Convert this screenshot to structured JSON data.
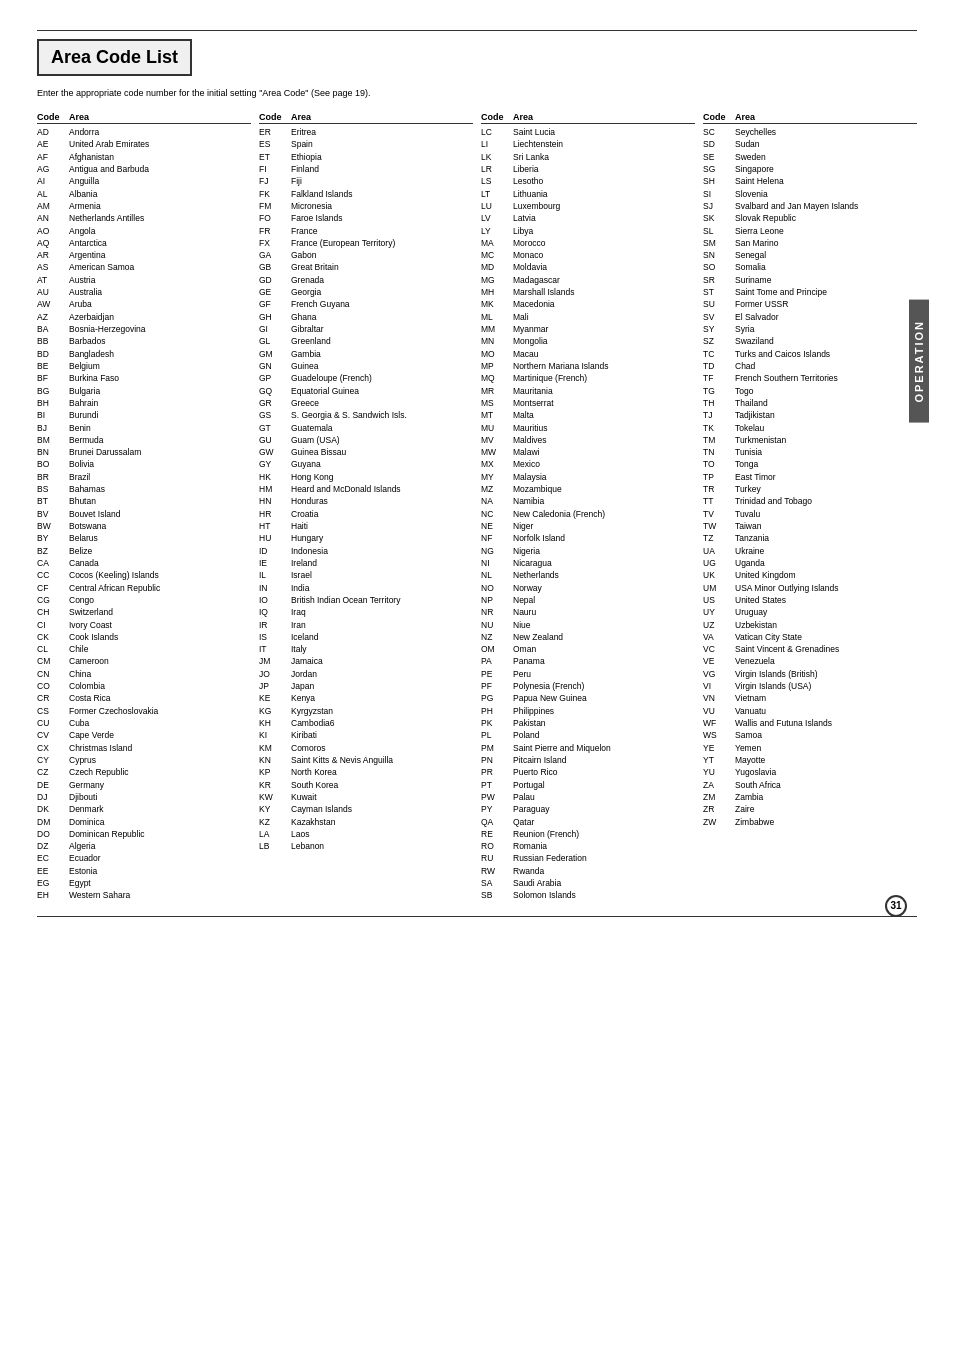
{
  "page": {
    "title": "Area Code List",
    "subtitle": "Enter the appropriate code number for the initial setting \"Area Code\" (See page 19).",
    "page_number": "31",
    "operation_label": "OPERATION"
  },
  "columns": [
    {
      "entries": [
        {
          "code": "AD",
          "area": "Andorra"
        },
        {
          "code": "AE",
          "area": "United Arab Emirates"
        },
        {
          "code": "AF",
          "area": "Afghanistan"
        },
        {
          "code": "AG",
          "area": "Antigua and Barbuda"
        },
        {
          "code": "AI",
          "area": "Anguilla"
        },
        {
          "code": "AL",
          "area": "Albania"
        },
        {
          "code": "AM",
          "area": "Armenia"
        },
        {
          "code": "AN",
          "area": "Netherlands Antilles"
        },
        {
          "code": "AO",
          "area": "Angola"
        },
        {
          "code": "AQ",
          "area": "Antarctica"
        },
        {
          "code": "AR",
          "area": "Argentina"
        },
        {
          "code": "AS",
          "area": "American Samoa"
        },
        {
          "code": "AT",
          "area": "Austria"
        },
        {
          "code": "AU",
          "area": "Australia"
        },
        {
          "code": "AW",
          "area": "Aruba"
        },
        {
          "code": "AZ",
          "area": "Azerbaidjan"
        },
        {
          "code": "BA",
          "area": "Bosnia-Herzegovina"
        },
        {
          "code": "BB",
          "area": "Barbados"
        },
        {
          "code": "BD",
          "area": "Bangladesh"
        },
        {
          "code": "BE",
          "area": "Belgium"
        },
        {
          "code": "BF",
          "area": "Burkina Faso"
        },
        {
          "code": "BG",
          "area": "Bulgaria"
        },
        {
          "code": "BH",
          "area": "Bahrain"
        },
        {
          "code": "BI",
          "area": "Burundi"
        },
        {
          "code": "BJ",
          "area": "Benin"
        },
        {
          "code": "BM",
          "area": "Bermuda"
        },
        {
          "code": "BN",
          "area": "Brunei Darussalam"
        },
        {
          "code": "BO",
          "area": "Bolivia"
        },
        {
          "code": "BR",
          "area": "Brazil"
        },
        {
          "code": "BS",
          "area": "Bahamas"
        },
        {
          "code": "BT",
          "area": "Bhutan"
        },
        {
          "code": "BV",
          "area": "Bouvet Island"
        },
        {
          "code": "BW",
          "area": "Botswana"
        },
        {
          "code": "BY",
          "area": "Belarus"
        },
        {
          "code": "BZ",
          "area": "Belize"
        },
        {
          "code": "CA",
          "area": "Canada"
        },
        {
          "code": "CC",
          "area": "Cocos (Keeling) Islands"
        },
        {
          "code": "CF",
          "area": "Central African Republic"
        },
        {
          "code": "CG",
          "area": "Congo"
        },
        {
          "code": "CH",
          "area": "Switzerland"
        },
        {
          "code": "CI",
          "area": "Ivory Coast"
        },
        {
          "code": "CK",
          "area": "Cook Islands"
        },
        {
          "code": "CL",
          "area": "Chile"
        },
        {
          "code": "CM",
          "area": "Cameroon"
        },
        {
          "code": "CN",
          "area": "China"
        },
        {
          "code": "CO",
          "area": "Colombia"
        },
        {
          "code": "CR",
          "area": "Costa Rica"
        },
        {
          "code": "CS",
          "area": "Former Czechoslovakia"
        },
        {
          "code": "CU",
          "area": "Cuba"
        },
        {
          "code": "CV",
          "area": "Cape Verde"
        },
        {
          "code": "CX",
          "area": "Christmas Island"
        },
        {
          "code": "CY",
          "area": "Cyprus"
        },
        {
          "code": "CZ",
          "area": "Czech Republic"
        },
        {
          "code": "DE",
          "area": "Germany"
        },
        {
          "code": "DJ",
          "area": "Djibouti"
        },
        {
          "code": "DK",
          "area": "Denmark"
        },
        {
          "code": "DM",
          "area": "Dominica"
        },
        {
          "code": "DO",
          "area": "Dominican Republic"
        },
        {
          "code": "DZ",
          "area": "Algeria"
        },
        {
          "code": "EC",
          "area": "Ecuador"
        },
        {
          "code": "EE",
          "area": "Estonia"
        },
        {
          "code": "EG",
          "area": "Egypt"
        },
        {
          "code": "EH",
          "area": "Western Sahara"
        }
      ]
    },
    {
      "entries": [
        {
          "code": "ER",
          "area": "Eritrea"
        },
        {
          "code": "ES",
          "area": "Spain"
        },
        {
          "code": "ET",
          "area": "Ethiopia"
        },
        {
          "code": "FI",
          "area": "Finland"
        },
        {
          "code": "FJ",
          "area": "Fiji"
        },
        {
          "code": "FK",
          "area": "Falkland Islands"
        },
        {
          "code": "FM",
          "area": "Micronesia"
        },
        {
          "code": "FO",
          "area": "Faroe Islands"
        },
        {
          "code": "FR",
          "area": "France"
        },
        {
          "code": "FX",
          "area": "France (European Territory)"
        },
        {
          "code": "GA",
          "area": "Gabon"
        },
        {
          "code": "GB",
          "area": "Great Britain"
        },
        {
          "code": "GD",
          "area": "Grenada"
        },
        {
          "code": "GE",
          "area": "Georgia"
        },
        {
          "code": "GF",
          "area": "French Guyana"
        },
        {
          "code": "GH",
          "area": "Ghana"
        },
        {
          "code": "GI",
          "area": "Gibraltar"
        },
        {
          "code": "GL",
          "area": "Greenland"
        },
        {
          "code": "GM",
          "area": "Gambia"
        },
        {
          "code": "GN",
          "area": "Guinea"
        },
        {
          "code": "GP",
          "area": "Guadeloupe (French)"
        },
        {
          "code": "GQ",
          "area": "Equatorial Guinea"
        },
        {
          "code": "GR",
          "area": "Greece"
        },
        {
          "code": "GS",
          "area": "S. Georgia & S. Sandwich Isls."
        },
        {
          "code": "GT",
          "area": "Guatemala"
        },
        {
          "code": "GU",
          "area": "Guam (USA)"
        },
        {
          "code": "GW",
          "area": "Guinea Bissau"
        },
        {
          "code": "GY",
          "area": "Guyana"
        },
        {
          "code": "HK",
          "area": "Hong Kong"
        },
        {
          "code": "HM",
          "area": "Heard and McDonald Islands"
        },
        {
          "code": "HN",
          "area": "Honduras"
        },
        {
          "code": "HR",
          "area": "Croatia"
        },
        {
          "code": "HT",
          "area": "Haiti"
        },
        {
          "code": "HU",
          "area": "Hungary"
        },
        {
          "code": "ID",
          "area": "Indonesia"
        },
        {
          "code": "IE",
          "area": "Ireland"
        },
        {
          "code": "IL",
          "area": "Israel"
        },
        {
          "code": "IN",
          "area": "India"
        },
        {
          "code": "IO",
          "area": "British Indian Ocean Territory"
        },
        {
          "code": "IQ",
          "area": "Iraq"
        },
        {
          "code": "IR",
          "area": "Iran"
        },
        {
          "code": "IS",
          "area": "Iceland"
        },
        {
          "code": "IT",
          "area": "Italy"
        },
        {
          "code": "JM",
          "area": "Jamaica"
        },
        {
          "code": "JO",
          "area": "Jordan"
        },
        {
          "code": "JP",
          "area": "Japan"
        },
        {
          "code": "KE",
          "area": "Kenya"
        },
        {
          "code": "KG",
          "area": "Kyrgyzstan"
        },
        {
          "code": "KH",
          "area": "Cambodia6"
        },
        {
          "code": "KI",
          "area": "Kiribati"
        },
        {
          "code": "KM",
          "area": "Comoros"
        },
        {
          "code": "KN",
          "area": "Saint Kitts & Nevis Anguilla"
        },
        {
          "code": "KP",
          "area": "North Korea"
        },
        {
          "code": "KR",
          "area": "South Korea"
        },
        {
          "code": "KW",
          "area": "Kuwait"
        },
        {
          "code": "KY",
          "area": "Cayman Islands"
        },
        {
          "code": "KZ",
          "area": "Kazakhstan"
        },
        {
          "code": "LA",
          "area": "Laos"
        },
        {
          "code": "LB",
          "area": "Lebanon"
        }
      ]
    },
    {
      "entries": [
        {
          "code": "LC",
          "area": "Saint Lucia"
        },
        {
          "code": "LI",
          "area": "Liechtenstein"
        },
        {
          "code": "LK",
          "area": "Sri Lanka"
        },
        {
          "code": "LR",
          "area": "Liberia"
        },
        {
          "code": "LS",
          "area": "Lesotho"
        },
        {
          "code": "LT",
          "area": "Lithuania"
        },
        {
          "code": "LU",
          "area": "Luxembourg"
        },
        {
          "code": "LV",
          "area": "Latvia"
        },
        {
          "code": "LY",
          "area": "Libya"
        },
        {
          "code": "MA",
          "area": "Morocco"
        },
        {
          "code": "MC",
          "area": "Monaco"
        },
        {
          "code": "MD",
          "area": "Moldavia"
        },
        {
          "code": "MG",
          "area": "Madagascar"
        },
        {
          "code": "MH",
          "area": "Marshall Islands"
        },
        {
          "code": "MK",
          "area": "Macedonia"
        },
        {
          "code": "ML",
          "area": "Mali"
        },
        {
          "code": "MM",
          "area": "Myanmar"
        },
        {
          "code": "MN",
          "area": "Mongolia"
        },
        {
          "code": "MO",
          "area": "Macau"
        },
        {
          "code": "MP",
          "area": "Northern Mariana Islands"
        },
        {
          "code": "MQ",
          "area": "Martinique (French)"
        },
        {
          "code": "MR",
          "area": "Mauritania"
        },
        {
          "code": "MS",
          "area": "Montserrat"
        },
        {
          "code": "MT",
          "area": "Malta"
        },
        {
          "code": "MU",
          "area": "Mauritius"
        },
        {
          "code": "MV",
          "area": "Maldives"
        },
        {
          "code": "MW",
          "area": "Malawi"
        },
        {
          "code": "MX",
          "area": "Mexico"
        },
        {
          "code": "MY",
          "area": "Malaysia"
        },
        {
          "code": "MZ",
          "area": "Mozambique"
        },
        {
          "code": "NA",
          "area": "Namibia"
        },
        {
          "code": "NC",
          "area": "New Caledonia (French)"
        },
        {
          "code": "NE",
          "area": "Niger"
        },
        {
          "code": "NF",
          "area": "Norfolk Island"
        },
        {
          "code": "NG",
          "area": "Nigeria"
        },
        {
          "code": "NI",
          "area": "Nicaragua"
        },
        {
          "code": "NL",
          "area": "Netherlands"
        },
        {
          "code": "NO",
          "area": "Norway"
        },
        {
          "code": "NP",
          "area": "Nepal"
        },
        {
          "code": "NR",
          "area": "Nauru"
        },
        {
          "code": "NU",
          "area": "Niue"
        },
        {
          "code": "NZ",
          "area": "New Zealand"
        },
        {
          "code": "OM",
          "area": "Oman"
        },
        {
          "code": "PA",
          "area": "Panama"
        },
        {
          "code": "PE",
          "area": "Peru"
        },
        {
          "code": "PF",
          "area": "Polynesia (French)"
        },
        {
          "code": "PG",
          "area": "Papua New Guinea"
        },
        {
          "code": "PH",
          "area": "Philippines"
        },
        {
          "code": "PK",
          "area": "Pakistan"
        },
        {
          "code": "PL",
          "area": "Poland"
        },
        {
          "code": "PM",
          "area": "Saint Pierre and Miquelon"
        },
        {
          "code": "PN",
          "area": "Pitcairn Island"
        },
        {
          "code": "PR",
          "area": "Puerto Rico"
        },
        {
          "code": "PT",
          "area": "Portugal"
        },
        {
          "code": "PW",
          "area": "Palau"
        },
        {
          "code": "PY",
          "area": "Paraguay"
        },
        {
          "code": "QA",
          "area": "Qatar"
        },
        {
          "code": "RE",
          "area": "Reunion (French)"
        },
        {
          "code": "RO",
          "area": "Romania"
        },
        {
          "code": "RU",
          "area": "Russian Federation"
        },
        {
          "code": "RW",
          "area": "Rwanda"
        },
        {
          "code": "SA",
          "area": "Saudi Arabia"
        },
        {
          "code": "SB",
          "area": "Solomon Islands"
        }
      ]
    },
    {
      "entries": [
        {
          "code": "SC",
          "area": "Seychelles"
        },
        {
          "code": "SD",
          "area": "Sudan"
        },
        {
          "code": "SE",
          "area": "Sweden"
        },
        {
          "code": "SG",
          "area": "Singapore"
        },
        {
          "code": "SH",
          "area": "Saint Helena"
        },
        {
          "code": "SI",
          "area": "Slovenia"
        },
        {
          "code": "SJ",
          "area": "Svalbard and Jan Mayen Islands"
        },
        {
          "code": "SK",
          "area": "Slovak Republic"
        },
        {
          "code": "SL",
          "area": "Sierra Leone"
        },
        {
          "code": "SM",
          "area": "San Marino"
        },
        {
          "code": "SN",
          "area": "Senegal"
        },
        {
          "code": "SO",
          "area": "Somalia"
        },
        {
          "code": "SR",
          "area": "Suriname"
        },
        {
          "code": "ST",
          "area": "Saint Tome and Principe"
        },
        {
          "code": "SU",
          "area": "Former USSR"
        },
        {
          "code": "SV",
          "area": "El Salvador"
        },
        {
          "code": "SY",
          "area": "Syria"
        },
        {
          "code": "SZ",
          "area": "Swaziland"
        },
        {
          "code": "TC",
          "area": "Turks and Caicos Islands"
        },
        {
          "code": "TD",
          "area": "Chad"
        },
        {
          "code": "TF",
          "area": "French Southern Territories"
        },
        {
          "code": "TG",
          "area": "Togo"
        },
        {
          "code": "TH",
          "area": "Thailand"
        },
        {
          "code": "TJ",
          "area": "Tadjikistan"
        },
        {
          "code": "TK",
          "area": "Tokelau"
        },
        {
          "code": "TM",
          "area": "Turkmenistan"
        },
        {
          "code": "TN",
          "area": "Tunisia"
        },
        {
          "code": "TO",
          "area": "Tonga"
        },
        {
          "code": "TP",
          "area": "East Timor"
        },
        {
          "code": "TR",
          "area": "Turkey"
        },
        {
          "code": "TT",
          "area": "Trinidad and Tobago"
        },
        {
          "code": "TV",
          "area": "Tuvalu"
        },
        {
          "code": "TW",
          "area": "Taiwan"
        },
        {
          "code": "TZ",
          "area": "Tanzania"
        },
        {
          "code": "UA",
          "area": "Ukraine"
        },
        {
          "code": "UG",
          "area": "Uganda"
        },
        {
          "code": "UK",
          "area": "United Kingdom"
        },
        {
          "code": "UM",
          "area": "USA Minor Outlying Islands"
        },
        {
          "code": "US",
          "area": "United States"
        },
        {
          "code": "UY",
          "area": "Uruguay"
        },
        {
          "code": "UZ",
          "area": "Uzbekistan"
        },
        {
          "code": "VA",
          "area": "Vatican City State"
        },
        {
          "code": "VC",
          "area": "Saint Vincent & Grenadines"
        },
        {
          "code": "VE",
          "area": "Venezuela"
        },
        {
          "code": "VG",
          "area": "Virgin Islands (British)"
        },
        {
          "code": "VI",
          "area": "Virgin Islands (USA)"
        },
        {
          "code": "VN",
          "area": "Vietnam"
        },
        {
          "code": "VU",
          "area": "Vanuatu"
        },
        {
          "code": "WF",
          "area": "Wallis and Futuna Islands"
        },
        {
          "code": "WS",
          "area": "Samoa"
        },
        {
          "code": "YE",
          "area": "Yemen"
        },
        {
          "code": "YT",
          "area": "Mayotte"
        },
        {
          "code": "YU",
          "area": "Yugoslavia"
        },
        {
          "code": "ZA",
          "area": "South Africa"
        },
        {
          "code": "ZM",
          "area": "Zambia"
        },
        {
          "code": "ZR",
          "area": "Zaire"
        },
        {
          "code": "ZW",
          "area": "Zimbabwe"
        }
      ]
    }
  ]
}
